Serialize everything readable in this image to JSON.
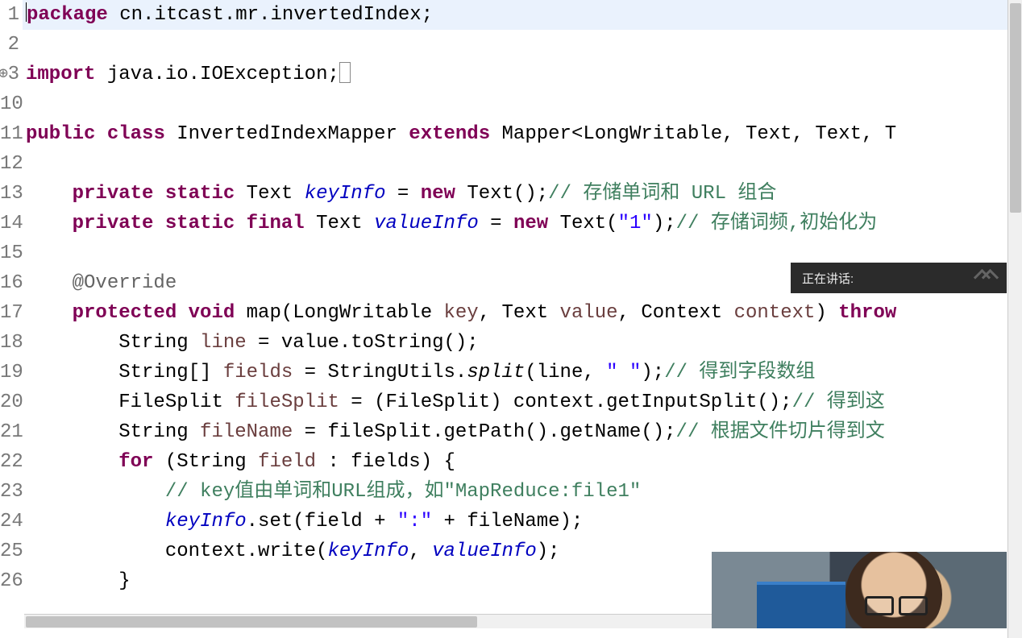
{
  "overlay": {
    "speaking_label": "正在讲话:"
  },
  "lines": {
    "l1": {
      "num": "1"
    },
    "l2": {
      "num": "2"
    },
    "l3": {
      "num": "3"
    },
    "l10": {
      "num": "10"
    },
    "l11": {
      "num": "11"
    },
    "l12": {
      "num": "12"
    },
    "l13": {
      "num": "13"
    },
    "l14": {
      "num": "14"
    },
    "l15": {
      "num": "15"
    },
    "l16": {
      "num": "16"
    },
    "l17": {
      "num": "17"
    },
    "l18": {
      "num": "18"
    },
    "l19": {
      "num": "19"
    },
    "l20": {
      "num": "20"
    },
    "l21": {
      "num": "21"
    },
    "l22": {
      "num": "22"
    },
    "l23": {
      "num": "23"
    },
    "l24": {
      "num": "24"
    },
    "l25": {
      "num": "25"
    },
    "l26": {
      "num": "26"
    }
  },
  "code": {
    "l1": {
      "kw": "package",
      "rest": " cn.itcast.mr.invertedIndex;"
    },
    "l3": {
      "kw": "import",
      "rest": " java.io.IOException;"
    },
    "l11": {
      "kw1": "public",
      "kw2": "class",
      "name": " InvertedIndexMapper ",
      "kw3": "extends",
      "rest": " Mapper<LongWritable, Text, Text, T"
    },
    "l13": {
      "indent": "    ",
      "kw1": "private",
      "kw2": "static",
      "type": " Text ",
      "fld": "keyInfo",
      "eq": " = ",
      "kw3": "new",
      "rest": " Text();",
      "cmt": "// 存储单词和 URL 组合"
    },
    "l14": {
      "indent": "    ",
      "kw1": "private",
      "kw2": "static",
      "kw3": "final",
      "type": " Text ",
      "fld": "valueInfo",
      "eq": " = ",
      "kw4": "new",
      "call": " Text(",
      "str": "\"1\"",
      "close": ");",
      "cmt": "// 存储词频,初始化为"
    },
    "l16": {
      "indent": "    ",
      "ann": "@Override"
    },
    "l17": {
      "indent": "    ",
      "kw1": "protected",
      "kw2": "void",
      "name": " map(LongWritable ",
      "p1": "key",
      "c1": ", Text ",
      "p2": "value",
      "c2": ", Context ",
      "p3": "context",
      "c3": ") ",
      "kw3": "throw"
    },
    "l18": {
      "indent": "        ",
      "t": "String ",
      "v": "line",
      "rest": " = value.toString();"
    },
    "l19": {
      "indent": "        ",
      "t": "String[] ",
      "v": "fields",
      "mid": " = StringUtils.",
      "it": "split",
      "args1": "(line, ",
      "str": "\" \"",
      "args2": ");",
      "cmt": "// 得到字段数组"
    },
    "l20": {
      "indent": "        ",
      "t": "FileSplit ",
      "v": "fileSplit",
      "rest": " = (FileSplit) context.getInputSplit();",
      "cmt": "// 得到这"
    },
    "l21": {
      "indent": "        ",
      "t": "String ",
      "v": "fileName",
      "rest": " = fileSplit.getPath().getName();",
      "cmt": "// 根据文件切片得到文"
    },
    "l22": {
      "indent": "        ",
      "kw": "for",
      "rest1": " (String ",
      "v": "field",
      "rest2": " : fields) {"
    },
    "l23": {
      "indent": "            ",
      "cmt": "// key值由单词和URL组成，如\"MapReduce:file1\""
    },
    "l24": {
      "indent": "            ",
      "fld": "keyInfo",
      "mid1": ".set(field + ",
      "str": "\":\"",
      "mid2": " + fileName);"
    },
    "l25": {
      "indent": "            ",
      "call1": "context.write(",
      "fld1": "keyInfo",
      "c": ", ",
      "fld2": "valueInfo",
      "call2": ");"
    },
    "l26": {
      "indent": "        ",
      "brace": "}"
    }
  }
}
